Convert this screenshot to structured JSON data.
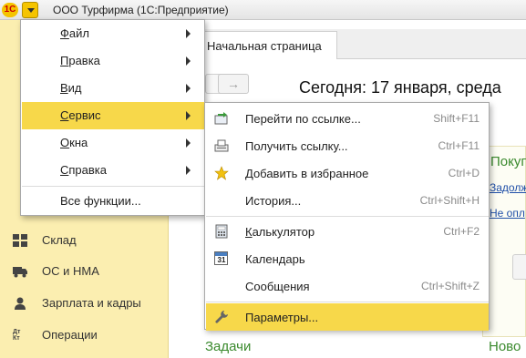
{
  "window": {
    "logo": "1С",
    "title": "ООО Турфирма  (1С:Предприятие)"
  },
  "tabs": {
    "home": "Начальная страница"
  },
  "content": {
    "forward_arrow": "→",
    "today": "Сегодня: 17 января, среда",
    "right_panel": {
      "title": "Покуп",
      "link1": "Задолж",
      "link2": "Не опл"
    },
    "tasks": "Задачи",
    "news": "Ново"
  },
  "sidebar": {
    "items": [
      {
        "label": "Склад",
        "icon": "warehouse-icon"
      },
      {
        "label": "ОС и НМА",
        "icon": "truck-icon"
      },
      {
        "label": "Зарплата и кадры",
        "icon": "person-icon"
      },
      {
        "label": "Операции",
        "icon": "dt-kt-icon",
        "icon_text": "Дт Кт"
      }
    ]
  },
  "main_menu": {
    "items": [
      {
        "label": "Файл",
        "accel": "Ф",
        "rest": "айл",
        "submenu": true
      },
      {
        "label": "Правка",
        "accel": "П",
        "rest": "равка",
        "submenu": true
      },
      {
        "label": "Вид",
        "accel": "В",
        "rest": "ид",
        "submenu": true
      },
      {
        "label": "Сервис",
        "accel": "С",
        "rest": "ервис",
        "submenu": true,
        "active": true
      },
      {
        "label": "Окна",
        "accel": "О",
        "rest": "кна",
        "submenu": true
      },
      {
        "label": "Справка",
        "accel": "С",
        "rest": "правка",
        "submenu": true
      },
      {
        "label": "Все функции...",
        "submenu": false
      }
    ]
  },
  "service_menu": {
    "items": [
      {
        "label": "Перейти по ссылке...",
        "shortcut": "Shift+F11",
        "icon": "go-to-link-icon"
      },
      {
        "label": "Получить ссылку...",
        "shortcut": "Ctrl+F11",
        "icon": "get-link-icon"
      },
      {
        "label": "Добавить в избранное",
        "shortcut": "Ctrl+D",
        "icon": "star-icon"
      },
      {
        "label": "История...",
        "shortcut": "Ctrl+Shift+H",
        "icon": ""
      },
      {
        "label": "Калькулятор",
        "accel": "К",
        "rest": "алькулятор",
        "shortcut": "Ctrl+F2",
        "icon": "calculator-icon"
      },
      {
        "label": "Календарь",
        "shortcut": "",
        "icon": "calendar-icon",
        "icon_text": "31"
      },
      {
        "label": "Сообщения",
        "shortcut": "Ctrl+Shift+Z",
        "icon": ""
      },
      {
        "label": "Параметры...",
        "shortcut": "",
        "icon": "wrench-icon",
        "active": true
      }
    ]
  },
  "colors": {
    "accent": "#f7d84a",
    "sidebar_bg": "#fbeeb0",
    "link": "#1f4fa8",
    "section_title": "#3b8a2e"
  }
}
